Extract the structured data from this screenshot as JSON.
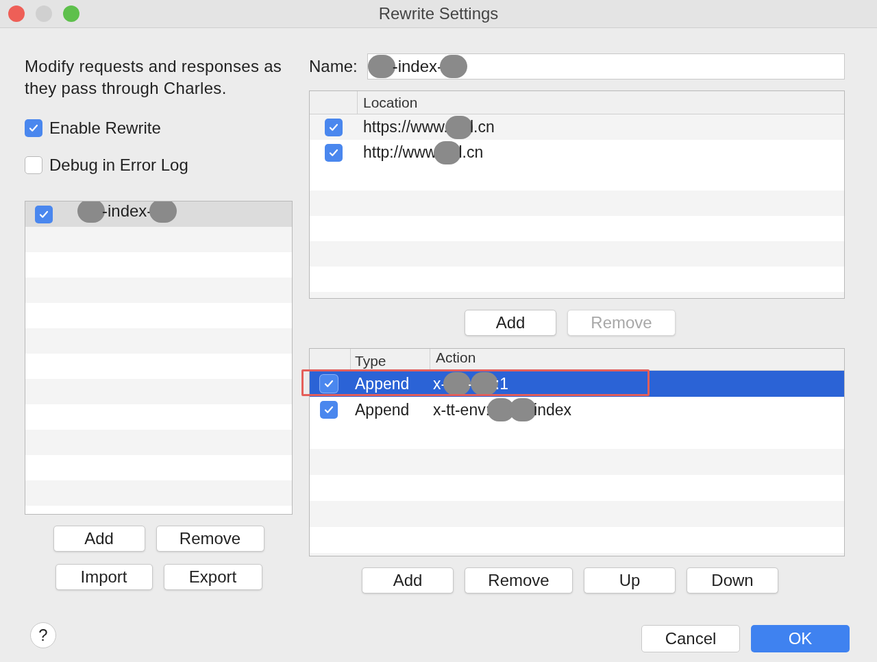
{
  "window": {
    "title": "Rewrite Settings"
  },
  "description": "Modify requests and responses as they pass through Charles.",
  "options": [
    {
      "label": "Enable Rewrite",
      "checked": true
    },
    {
      "label": "Debug in Error Log",
      "checked": false
    }
  ],
  "sets": [
    {
      "checked": true,
      "selected": true,
      "segments": [
        {
          "kind": "redacted"
        },
        {
          "kind": "text",
          "text": "-index-"
        },
        {
          "kind": "redacted"
        }
      ]
    }
  ],
  "set_buttons": [
    [
      "Add",
      "Remove"
    ],
    [
      "Import",
      "Export"
    ]
  ],
  "name": {
    "label": "Name:",
    "segments": [
      {
        "kind": "redacted"
      },
      {
        "kind": "text",
        "text": "-index-"
      },
      {
        "kind": "redacted"
      }
    ]
  },
  "locations": {
    "columns": [
      "Location"
    ],
    "rows": [
      {
        "checked": true,
        "segments": [
          {
            "kind": "text",
            "text": "https://www."
          },
          {
            "kind": "redacted"
          },
          {
            "kind": "text",
            "text": "l.cn"
          }
        ]
      },
      {
        "checked": true,
        "segments": [
          {
            "kind": "text",
            "text": "http://www"
          },
          {
            "kind": "redacted"
          },
          {
            "kind": "text",
            "text": "l.cn"
          }
        ]
      }
    ],
    "buttons": [
      {
        "label": "Add",
        "disabled": false
      },
      {
        "label": "Remove",
        "disabled": true
      }
    ]
  },
  "rules": {
    "columns": [
      "Type",
      "Action"
    ],
    "rows": [
      {
        "checked": true,
        "selected": true,
        "type": "Append",
        "segments": [
          {
            "kind": "text",
            "text": "x-"
          },
          {
            "kind": "redacted"
          },
          {
            "kind": "text",
            "text": "-"
          },
          {
            "kind": "redacted"
          },
          {
            "kind": "text",
            "text": ":1"
          }
        ]
      },
      {
        "checked": true,
        "selected": false,
        "type": "Append",
        "segments": [
          {
            "kind": "text",
            "text": "x-tt-env:"
          },
          {
            "kind": "redacted"
          },
          {
            "kind": "redacted"
          },
          {
            "kind": "text",
            "text": "index"
          }
        ]
      }
    ],
    "buttons": [
      "Add",
      "Remove",
      "Up",
      "Down"
    ]
  },
  "help": "?",
  "footer_buttons": [
    {
      "label": "Cancel",
      "primary": false
    },
    {
      "label": "OK",
      "primary": true
    }
  ]
}
